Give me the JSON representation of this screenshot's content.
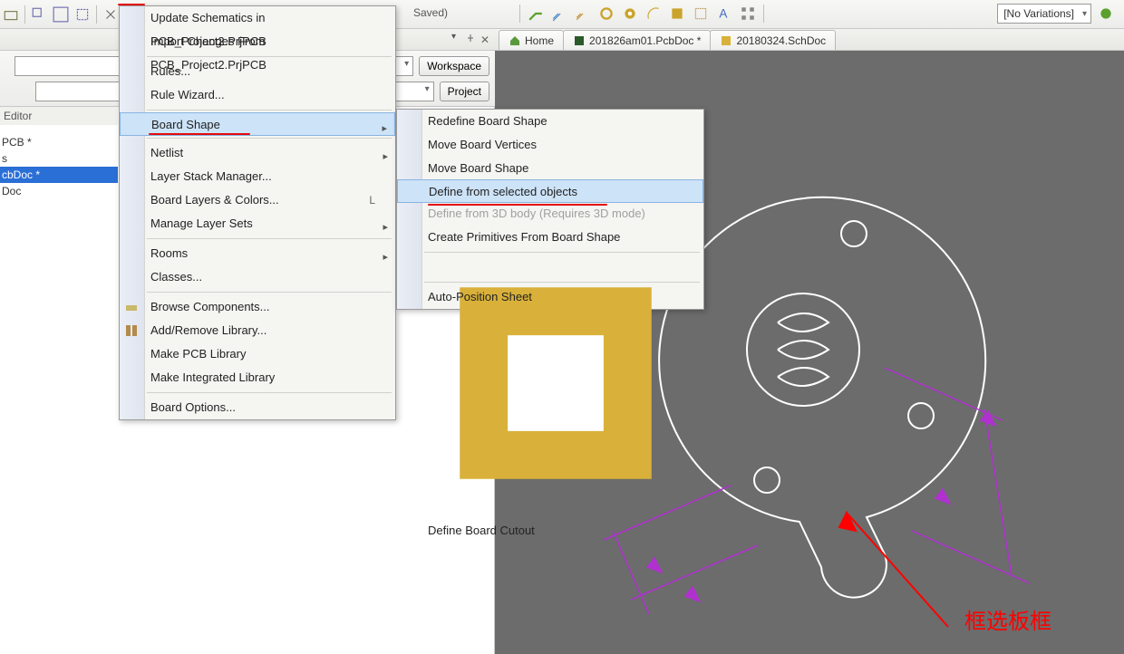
{
  "toolbar": {
    "saved_label": "Saved)",
    "variations_label": "[No Variations]"
  },
  "doc_tabs": {
    "home": "Home",
    "pcb": "201826am01.PcbDoc *",
    "sch": "20180324.SchDoc"
  },
  "projects_panel": {
    "workspace_btn": "Workspace",
    "project_btn": "Project",
    "editor_label": "Editor",
    "tree": {
      "root": "PCB *",
      "child1": "s",
      "child2": "cbDoc *",
      "child3": "Doc"
    }
  },
  "design_menu": {
    "update_schematics": "Update Schematics in PCB_Project2.PrjPCB",
    "import_changes": "Import Changes From PCB_Project2.PrjPCB",
    "rules": "Rules...",
    "rule_wizard": "Rule Wizard...",
    "board_shape": "Board Shape",
    "netlist": "Netlist",
    "layer_stack": "Layer Stack Manager...",
    "board_layers": "Board Layers & Colors...",
    "board_layers_short": "L",
    "manage_layer_sets": "Manage Layer Sets",
    "rooms": "Rooms",
    "classes": "Classes...",
    "browse_components": "Browse Components...",
    "add_remove_lib": "Add/Remove Library...",
    "make_pcb_lib": "Make PCB Library",
    "make_int_lib": "Make Integrated Library",
    "board_options": "Board Options..."
  },
  "board_shape_submenu": {
    "redefine": "Redefine Board Shape",
    "move_vertices": "Move Board Vertices",
    "move_shape": "Move Board Shape",
    "define_selected": "Define from selected objects",
    "define_3d": "Define from 3D body (Requires 3D mode)",
    "create_prims": "Create Primitives From Board Shape",
    "define_cutout": "Define Board Cutout",
    "auto_position": "Auto-Position Sheet"
  },
  "annotation": {
    "text": "框选板框"
  }
}
